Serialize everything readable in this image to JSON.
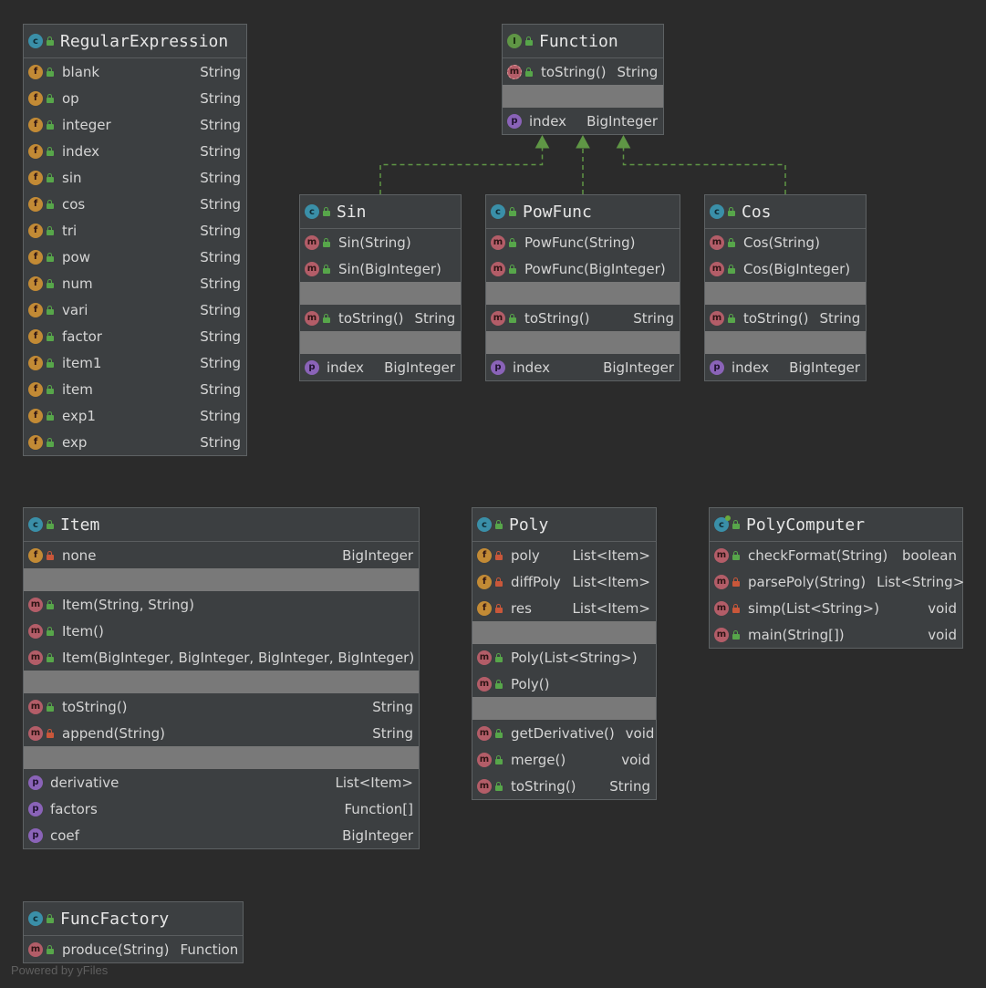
{
  "diagram": {
    "classes": [
      {
        "id": "RegularExpression",
        "title": "RegularExpression",
        "kind": "class",
        "sections": [
          {
            "type": "members",
            "members": [
              {
                "icon": "f",
                "vis": "public",
                "name": "blank",
                "type": "String"
              },
              {
                "icon": "f",
                "vis": "public",
                "name": "op",
                "type": "String"
              },
              {
                "icon": "f",
                "vis": "public",
                "name": "integer",
                "type": "String"
              },
              {
                "icon": "f",
                "vis": "public",
                "name": "index",
                "type": "String"
              },
              {
                "icon": "f",
                "vis": "public",
                "name": "sin",
                "type": "String"
              },
              {
                "icon": "f",
                "vis": "public",
                "name": "cos",
                "type": "String"
              },
              {
                "icon": "f",
                "vis": "public",
                "name": "tri",
                "type": "String"
              },
              {
                "icon": "f",
                "vis": "public",
                "name": "pow",
                "type": "String"
              },
              {
                "icon": "f",
                "vis": "public",
                "name": "num",
                "type": "String"
              },
              {
                "icon": "f",
                "vis": "public",
                "name": "vari",
                "type": "String"
              },
              {
                "icon": "f",
                "vis": "public",
                "name": "factor",
                "type": "String"
              },
              {
                "icon": "f",
                "vis": "public",
                "name": "item1",
                "type": "String"
              },
              {
                "icon": "f",
                "vis": "public",
                "name": "item",
                "type": "String"
              },
              {
                "icon": "f",
                "vis": "public",
                "name": "exp1",
                "type": "String"
              },
              {
                "icon": "f",
                "vis": "public",
                "name": "exp",
                "type": "String"
              }
            ]
          }
        ]
      },
      {
        "id": "Function",
        "title": "Function",
        "kind": "interface",
        "sections": [
          {
            "type": "members",
            "members": [
              {
                "icon": "mi",
                "vis": "public",
                "name": "toString()",
                "type": "String"
              }
            ]
          },
          {
            "type": "sep"
          },
          {
            "type": "members",
            "members": [
              {
                "icon": "p",
                "vis": "none",
                "name": "index",
                "type": "BigInteger"
              }
            ]
          }
        ]
      },
      {
        "id": "Sin",
        "title": "Sin",
        "kind": "class",
        "sections": [
          {
            "type": "members",
            "members": [
              {
                "icon": "m",
                "vis": "public",
                "name": "Sin(String)",
                "type": ""
              },
              {
                "icon": "m",
                "vis": "public",
                "name": "Sin(BigInteger)",
                "type": ""
              }
            ]
          },
          {
            "type": "sep"
          },
          {
            "type": "members",
            "members": [
              {
                "icon": "m",
                "vis": "public",
                "name": "toString()",
                "type": "String"
              }
            ]
          },
          {
            "type": "sep"
          },
          {
            "type": "members",
            "members": [
              {
                "icon": "p",
                "vis": "none",
                "name": "index",
                "type": "BigInteger"
              }
            ]
          }
        ]
      },
      {
        "id": "PowFunc",
        "title": "PowFunc",
        "kind": "class",
        "sections": [
          {
            "type": "members",
            "members": [
              {
                "icon": "m",
                "vis": "public",
                "name": "PowFunc(String)",
                "type": ""
              },
              {
                "icon": "m",
                "vis": "public",
                "name": "PowFunc(BigInteger)",
                "type": ""
              }
            ]
          },
          {
            "type": "sep"
          },
          {
            "type": "members",
            "members": [
              {
                "icon": "m",
                "vis": "public",
                "name": "toString()",
                "type": "String"
              }
            ]
          },
          {
            "type": "sep"
          },
          {
            "type": "members",
            "members": [
              {
                "icon": "p",
                "vis": "none",
                "name": "index",
                "type": "BigInteger"
              }
            ]
          }
        ]
      },
      {
        "id": "Cos",
        "title": "Cos",
        "kind": "class",
        "sections": [
          {
            "type": "members",
            "members": [
              {
                "icon": "m",
                "vis": "public",
                "name": "Cos(String)",
                "type": ""
              },
              {
                "icon": "m",
                "vis": "public",
                "name": "Cos(BigInteger)",
                "type": ""
              }
            ]
          },
          {
            "type": "sep"
          },
          {
            "type": "members",
            "members": [
              {
                "icon": "m",
                "vis": "public",
                "name": "toString()",
                "type": "String"
              }
            ]
          },
          {
            "type": "sep"
          },
          {
            "type": "members",
            "members": [
              {
                "icon": "p",
                "vis": "none",
                "name": "index",
                "type": "BigInteger"
              }
            ]
          }
        ]
      },
      {
        "id": "Item",
        "title": "Item",
        "kind": "class",
        "sections": [
          {
            "type": "members",
            "members": [
              {
                "icon": "f",
                "vis": "private",
                "name": "none",
                "type": "BigInteger"
              }
            ]
          },
          {
            "type": "sep"
          },
          {
            "type": "members",
            "members": [
              {
                "icon": "m",
                "vis": "public",
                "name": "Item(String, String)",
                "type": ""
              },
              {
                "icon": "m",
                "vis": "public",
                "name": "Item()",
                "type": ""
              },
              {
                "icon": "m",
                "vis": "public",
                "name": "Item(BigInteger, BigInteger, BigInteger, BigInteger)",
                "type": ""
              }
            ]
          },
          {
            "type": "sep"
          },
          {
            "type": "members",
            "members": [
              {
                "icon": "m",
                "vis": "public",
                "name": "toString()",
                "type": "String"
              },
              {
                "icon": "m",
                "vis": "private",
                "name": "append(String)",
                "type": "String"
              }
            ]
          },
          {
            "type": "sep"
          },
          {
            "type": "members",
            "members": [
              {
                "icon": "p",
                "vis": "none",
                "name": "derivative",
                "type": "List<Item>"
              },
              {
                "icon": "p",
                "vis": "none",
                "name": "factors",
                "type": "Function[]"
              },
              {
                "icon": "p",
                "vis": "none",
                "name": "coef",
                "type": "BigInteger"
              }
            ]
          }
        ]
      },
      {
        "id": "Poly",
        "title": "Poly",
        "kind": "class",
        "sections": [
          {
            "type": "members",
            "members": [
              {
                "icon": "f",
                "vis": "private",
                "name": "poly",
                "type": "List<Item>"
              },
              {
                "icon": "f",
                "vis": "private",
                "name": "diffPoly",
                "type": "List<Item>"
              },
              {
                "icon": "f",
                "vis": "private",
                "name": "res",
                "type": "List<Item>"
              }
            ]
          },
          {
            "type": "sep"
          },
          {
            "type": "members",
            "members": [
              {
                "icon": "m",
                "vis": "public",
                "name": "Poly(List<String>)",
                "type": ""
              },
              {
                "icon": "m",
                "vis": "public",
                "name": "Poly()",
                "type": ""
              }
            ]
          },
          {
            "type": "sep"
          },
          {
            "type": "members",
            "members": [
              {
                "icon": "m",
                "vis": "public",
                "name": "getDerivative()",
                "type": "void"
              },
              {
                "icon": "m",
                "vis": "public",
                "name": "merge()",
                "type": "void"
              },
              {
                "icon": "m",
                "vis": "public",
                "name": "toString()",
                "type": "String"
              }
            ]
          }
        ]
      },
      {
        "id": "PolyComputer",
        "title": "PolyComputer",
        "kind": "main",
        "sections": [
          {
            "type": "members",
            "members": [
              {
                "icon": "m",
                "vis": "public",
                "name": "checkFormat(String)",
                "type": "boolean"
              },
              {
                "icon": "m",
                "vis": "private",
                "name": "parsePoly(String)",
                "type": "List<String>"
              },
              {
                "icon": "m",
                "vis": "private",
                "name": "simp(List<String>)",
                "type": "void"
              },
              {
                "icon": "m",
                "vis": "public",
                "name": "main(String[])",
                "type": "void"
              }
            ]
          }
        ]
      },
      {
        "id": "FuncFactory",
        "title": "FuncFactory",
        "kind": "class",
        "sections": [
          {
            "type": "members",
            "members": [
              {
                "icon": "m",
                "vis": "public",
                "name": "produce(String)",
                "type": "Function"
              }
            ]
          }
        ]
      }
    ],
    "edges": [
      {
        "from": "Sin",
        "to": "Function",
        "kind": "implements"
      },
      {
        "from": "PowFunc",
        "to": "Function",
        "kind": "implements"
      },
      {
        "from": "Cos",
        "to": "Function",
        "kind": "implements"
      }
    ],
    "colors": {
      "background": "#2b2b2b",
      "node": "#3c3f41",
      "separator": "#797979",
      "edge": "#5f9645"
    }
  },
  "footer": {
    "watermark": "Powered by yFiles"
  }
}
